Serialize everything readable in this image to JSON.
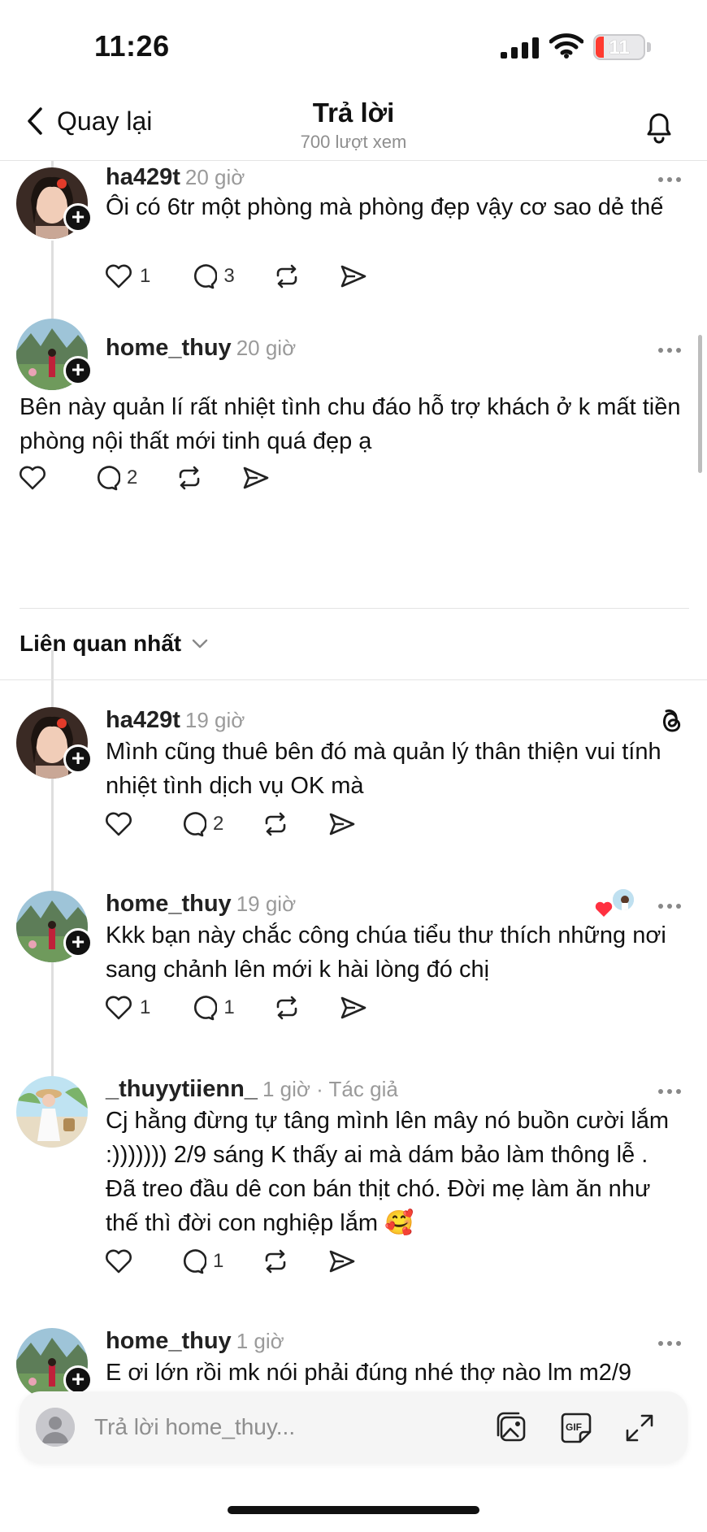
{
  "status_bar": {
    "time": "11:26",
    "battery": "11"
  },
  "header": {
    "back_label": "Quay lại",
    "title": "Trả lời",
    "views": "700 lượt xem"
  },
  "posts_top": [
    {
      "username": "ha429t",
      "time": "20 giờ",
      "text": "Ôi có 6tr một phòng mà phòng đẹp vậy cơ sao dẻ thế",
      "likes": "1",
      "comments": "3",
      "avatar": "girl-avatar"
    },
    {
      "username": "home_thuy",
      "time": "20 giờ",
      "text": "Bên này quản lí rất nhiệt tình chu đáo hỗ trợ khách ở k mất tiền phòng nội thất mới tinh quá đẹp ạ",
      "likes": "",
      "comments": "2",
      "avatar": "landscape-avatar"
    }
  ],
  "sort": {
    "label": "Liên quan nhất"
  },
  "replies": [
    {
      "username": "ha429t",
      "time": "19 giờ",
      "text": "Mình cũng thuê bên đó mà  quản lý thân thiện vui tính nhiệt tình dịch vụ OK mà",
      "likes": "",
      "comments": "2",
      "avatar": "girl-avatar"
    },
    {
      "username": "home_thuy",
      "time": "19 giờ",
      "text": "Kkk bạn này chắc công chúa tiểu thư thích những nơi sang chảnh lên mới k hài lòng đó chị",
      "likes": "1",
      "comments": "1",
      "avatar": "landscape-avatar"
    },
    {
      "username": "_thuyytiienn_",
      "time": "1 giờ · Tác giả",
      "text": "Cj hằng đừng tự tâng mình lên mây nó buồn cười lắm :))))))) 2/9 sáng K thấy ai mà dám bảo làm thông lễ . Đã treo đầu dê con bán thịt chó. Đời mẹ làm ăn như thế thì đời con nghiệp lắm 🥰",
      "likes": "",
      "comments": "1",
      "avatar": "beach-avatar"
    },
    {
      "username": "home_thuy",
      "time": "1 giờ",
      "text": "E ơi lớn rồi mk nói phải đúng nhé thợ nào lm m2/9",
      "avatar": "landscape-avatar"
    }
  ],
  "reply_bar": {
    "placeholder": "Trả lời home_thuy..."
  },
  "colors": {
    "accent_red": "#ff3b30",
    "divider": "#e4e4e4",
    "muted_text": "#9a9a9a"
  }
}
